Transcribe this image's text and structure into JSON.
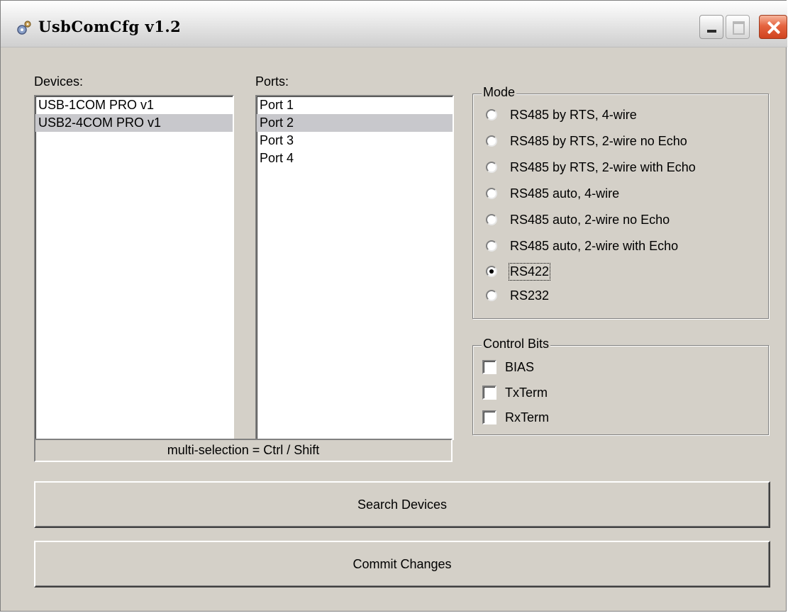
{
  "window": {
    "title": "UsbComCfg v1.2"
  },
  "devices": {
    "label": "Devices:",
    "items": [
      {
        "label": "USB-1COM PRO v1",
        "selected": false
      },
      {
        "label": "USB2-4COM PRO v1",
        "selected": true
      }
    ]
  },
  "ports": {
    "label": "Ports:",
    "items": [
      {
        "label": "Port 1",
        "selected": false
      },
      {
        "label": "Port 2",
        "selected": true
      },
      {
        "label": "Port 3",
        "selected": false
      },
      {
        "label": "Port 4",
        "selected": false
      }
    ]
  },
  "status": {
    "hint": "multi-selection = Ctrl / Shift"
  },
  "mode": {
    "title": "Mode",
    "options": [
      {
        "label": "RS485 by RTS, 4-wire",
        "checked": false
      },
      {
        "label": "RS485 by RTS, 2-wire no Echo",
        "checked": false
      },
      {
        "label": "RS485 by RTS, 2-wire with Echo",
        "checked": false
      },
      {
        "label": "RS485 auto, 4-wire",
        "checked": false
      },
      {
        "label": "RS485 auto, 2-wire no Echo",
        "checked": false
      },
      {
        "label": "RS485 auto, 2-wire with Echo",
        "checked": false
      },
      {
        "label": "RS422",
        "checked": true
      },
      {
        "label": "RS232",
        "checked": false
      }
    ]
  },
  "control_bits": {
    "title": "Control Bits",
    "options": [
      {
        "label": "BIAS",
        "checked": false
      },
      {
        "label": "TxTerm",
        "checked": false
      },
      {
        "label": "RxTerm",
        "checked": false
      }
    ]
  },
  "buttons": {
    "search": "Search Devices",
    "commit": "Commit Changes"
  }
}
